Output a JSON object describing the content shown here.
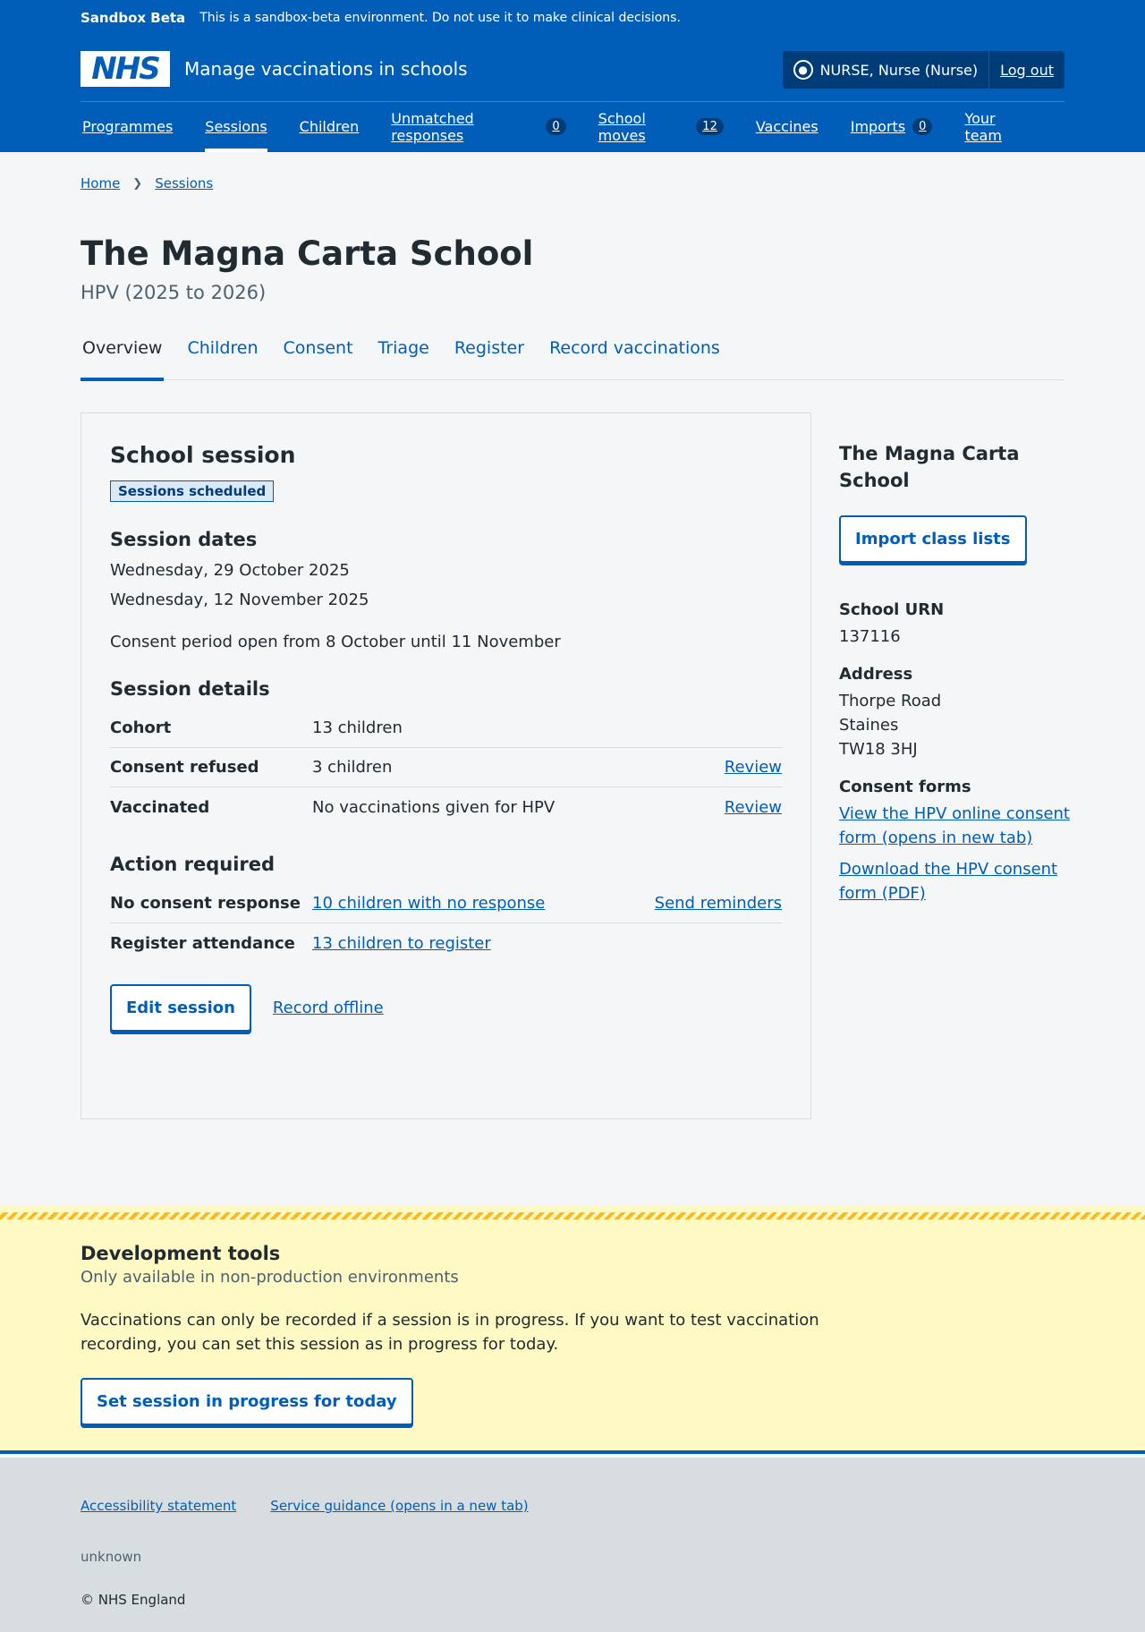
{
  "sandbox": {
    "tag": "Sandbox Beta",
    "message": "This is a sandbox-beta environment. Do not use it to make clinical decisions."
  },
  "header": {
    "logo_text": "NHS",
    "service_name": "Manage vaccinations in schools",
    "user": "NURSE, Nurse (Nurse)",
    "logout": "Log out"
  },
  "nav": [
    {
      "label": "Programmes"
    },
    {
      "label": "Sessions"
    },
    {
      "label": "Children"
    },
    {
      "label": "Unmatched responses",
      "count": "0"
    },
    {
      "label": "School moves",
      "count": "12"
    },
    {
      "label": "Vaccines"
    },
    {
      "label": "Imports",
      "count": "0"
    },
    {
      "label": "Your team"
    }
  ],
  "breadcrumb": [
    "Home",
    "Sessions"
  ],
  "page": {
    "title": "The Magna Carta School",
    "subtitle": "HPV (2025 to 2026)"
  },
  "tabs": [
    "Overview",
    "Children",
    "Consent",
    "Triage",
    "Register",
    "Record vaccinations"
  ],
  "session_card": {
    "title": "School session",
    "status": "Sessions scheduled",
    "dates_heading": "Session dates",
    "dates": [
      "Wednesday, 29 October 2025",
      "Wednesday, 12 November 2025"
    ],
    "consent_period": "Consent period open from 8 October until 11 November",
    "details_heading": "Session details",
    "details": [
      {
        "key": "Cohort",
        "value": "13 children",
        "action": ""
      },
      {
        "key": "Consent refused",
        "value": "3 children",
        "action": "Review"
      },
      {
        "key": "Vaccinated",
        "value": "No vaccinations given for HPV",
        "action": "Review"
      }
    ],
    "action_heading": "Action required",
    "actions": [
      {
        "key": "No consent response",
        "value": "10 children with no response",
        "action": "Send reminders"
      },
      {
        "key": "Register attendance",
        "value": "13 children to register",
        "action": ""
      }
    ],
    "edit_button": "Edit session",
    "offline_link": "Record offline"
  },
  "aside": {
    "title": "The Magna Carta School",
    "import_button": "Import class lists",
    "urn_label": "School URN",
    "urn": "137116",
    "address_label": "Address",
    "address": [
      "Thorpe Road",
      "Staines",
      "TW18 3HJ"
    ],
    "forms_label": "Consent forms",
    "form_links": [
      "View the HPV online consent form (opens in new tab)",
      "Download the HPV consent form (PDF)"
    ]
  },
  "devtools": {
    "title": "Development tools",
    "subtitle": "Only available in non-production environments",
    "text": "Vaccinations can only be recorded if a session is in progress. If you want to test vaccination recording, you can set this session as in progress for today.",
    "button": "Set session in progress for today"
  },
  "footer": {
    "links": [
      "Accessibility statement",
      "Service guidance (opens in a new tab)"
    ],
    "version": "unknown",
    "copyright": "© NHS England"
  },
  "colors": {
    "brand": "#005eb8",
    "dark_blue": "#003d78",
    "devtools_bg": "#fff9c4",
    "warning_stripe": "#ffb81c"
  }
}
